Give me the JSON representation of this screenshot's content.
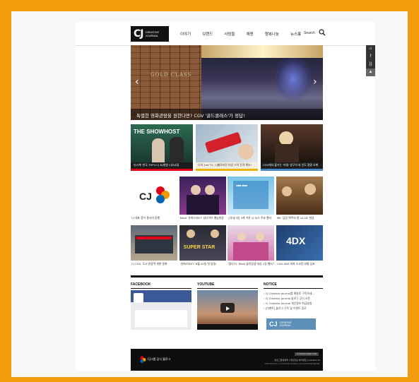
{
  "colors": {
    "background": "#f39a0d",
    "header_logo": "#111111",
    "footer": "#0e0e0e"
  },
  "logo": {
    "mark": "CJ",
    "line1": "CREATIVE",
    "line2": "JOURNAL"
  },
  "nav": [
    "이야기",
    "브랜드",
    "사람들",
    "채용",
    "행복나눔",
    "뉴스룸"
  ],
  "search": {
    "label": "Search"
  },
  "side_icons": [
    "home-icon",
    "facebook-icon",
    "rss-icon",
    "top-icon"
  ],
  "hero": {
    "brand": "GOLD CLASS",
    "caption": "특별한 영화관람을 원한다면? CGV '골드클래스'가 정답!",
    "prev": "‹",
    "next": "›"
  },
  "row1": [
    {
      "caption": "'슈스케' 한국 TOP4 CJ 쇼/원방 CJ오쇼핑"
    },
    {
      "caption": "나의 2nd TV, CJ헬로비전 티빙 스틱 전격 해부!"
    },
    {
      "caption": "CGV에서 즐기는 '미생' 방구석 와 인도 정말 오케"
    }
  ],
  "row2": [
    {
      "caption": "CJ 대표 정기 봉사의 동행"
    },
    {
      "caption": "Mnet '슈퍼스타K7' 성다이브 예능현장"
    },
    {
      "caption": "[국내/ 외] 3개 가지 CJ 뉴스 주요 행사"
    },
    {
      "caption": "MK '김장 맥주의 향 10.16' 현장"
    }
  ],
  "row3": [
    {
      "caption": "CJ CGV, 도시 관광객 위한 동화"
    },
    {
      "caption": "'슈퍼스타K7' 8월 20일 첫 방송!"
    },
    {
      "caption": "엠디TV, Mnet 슬직장생 대상 1등 행사 보산"
    },
    {
      "caption": "CGV 4DX 마지 스크린 대형 심포"
    }
  ],
  "sections": {
    "facebook": "FACEBOOK",
    "youtube": "YOUTUBE",
    "notice": "NOTICE"
  },
  "notice_items": [
    "CJ Creative Journal를 해필로 구독하세...",
    "CJ Creative Journal 블로그 공식 오픈",
    "CJ Creative Journal 개인정보 취급방침",
    "[이벤트] 블로그 구독 및 이벤트 응모",
    "CJ 홈페이지 개편 안내"
  ],
  "notice_banner": {
    "mark": "CJ",
    "line1": "CREATIVE",
    "line2": "JOURNAL"
  },
  "footer": {
    "brand": "CJ그룹 공식 블로그",
    "links": "블로그운영정책  |  개인정보 처리방침  |  Contact Us",
    "copyright": "COPYRIGHT(C) CJ CREATIVE JOURNAL. ALL RIGHTS RESERVED.",
    "family_site": "CJ GROUP FAMILY SITE"
  }
}
